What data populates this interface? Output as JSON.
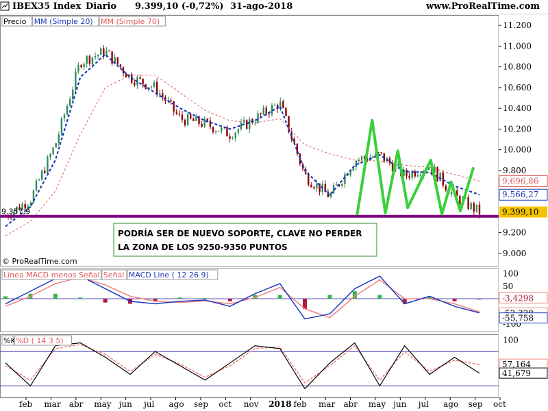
{
  "header": {
    "symbol": "IBEX35 Index",
    "period": "Diario",
    "quote": "9.399,10 (-0,72%)",
    "date": "31-ago-2018",
    "site": "www.ProRealTime.com",
    "icon": "bar-chart-icon"
  },
  "copyright": "© ProRealTime.com",
  "colors": {
    "price_up": "#2e8b57",
    "price_down": "#8b0000",
    "ma20": "#1c39bb",
    "ma70": "#e05a5a",
    "support": "#800080",
    "pattern": "#39d03a",
    "annotation_border": "#2e8b2e",
    "current_price_bg": "#f5c400"
  },
  "chart_data": [
    {
      "type": "line",
      "panel": "price",
      "legend": [
        "Precio",
        "MM (Simple 20)",
        "MM (Simple 70)"
      ],
      "x": [
        "feb",
        "mar",
        "abr",
        "may",
        "jun",
        "jul",
        "ago",
        "sep",
        "oct",
        "nov",
        "2018",
        "feb",
        "mar",
        "abr",
        "may",
        "jun",
        "jul",
        "ago",
        "sep",
        "oct"
      ],
      "ylim": [
        8880,
        11300
      ],
      "yticks": [
        "11.200",
        "11.000",
        "10.800",
        "10.600",
        "10.400",
        "10.200",
        "10.000",
        "9.800",
        "9.200",
        "9.000"
      ],
      "ytick_values": [
        11200,
        11000,
        10800,
        10600,
        10400,
        10200,
        10000,
        9800,
        9200,
        9000
      ],
      "value_labels": [
        {
          "text": "9.696,86",
          "value": 9697,
          "series": "MM (Simple 70)"
        },
        {
          "text": "9.566,27",
          "value": 9566,
          "series": "MM (Simple 20)"
        },
        {
          "text": "9.399,10",
          "value": 9399,
          "series": "Precio"
        }
      ],
      "left_label": "9.357,9",
      "series": [
        {
          "name": "Precio",
          "values": [
            9360,
            9520,
            10050,
            10850,
            10950,
            10700,
            10600,
            10300,
            10250,
            10150,
            10300,
            10450,
            9750,
            9550,
            9900,
            9950,
            9750,
            9850,
            9550,
            9399
          ]
        },
        {
          "name": "MM (Simple 20)",
          "values": [
            9260,
            9450,
            9900,
            10700,
            10920,
            10700,
            10550,
            10400,
            10280,
            10200,
            10280,
            10420,
            9800,
            9560,
            9850,
            9950,
            9790,
            9780,
            9650,
            9566
          ]
        },
        {
          "name": "MM (Simple 70)",
          "values": [
            9170,
            9310,
            9600,
            10150,
            10600,
            10720,
            10720,
            10550,
            10380,
            10280,
            10260,
            10300,
            10050,
            9960,
            9900,
            9890,
            9850,
            9830,
            9760,
            9697
          ]
        }
      ],
      "support_level": 9357.9,
      "annotation": [
        "PODRÍA SER DE NUEVO SOPORTE, CLAVE NO PERDER",
        "LA ZONA DE LOS 9250-9350 PUNTOS"
      ],
      "pattern_points": [
        [
          543,
          9370
        ],
        [
          566,
          10285
        ],
        [
          586,
          9390
        ],
        [
          605,
          9990
        ],
        [
          620,
          9440
        ],
        [
          655,
          9900
        ],
        [
          672,
          9380
        ],
        [
          686,
          9690
        ],
        [
          700,
          9410
        ],
        [
          720,
          9830
        ]
      ]
    },
    {
      "type": "bar",
      "panel": "macd",
      "legend": [
        "Línea MACD menos Señal",
        "Señal",
        "MACD Line ( 12 26 9)"
      ],
      "yticks": [
        "100",
        "50",
        "-100"
      ],
      "ytick_values": [
        100,
        50,
        -100
      ],
      "ylim": [
        -130,
        120
      ],
      "value_labels": [
        {
          "text": "-3,4298",
          "value": -3.4
        },
        {
          "text": "-52,328",
          "value": -52.3
        },
        {
          "text": "-55,758",
          "value": -55.8
        }
      ],
      "series": [
        {
          "name": "MACD Line ( 12 26 9)",
          "values": [
            -20,
            30,
            80,
            90,
            40,
            -10,
            -20,
            -10,
            -5,
            -30,
            20,
            60,
            -80,
            -60,
            40,
            90,
            -20,
            10,
            -30,
            -56
          ]
        },
        {
          "name": "Señal",
          "values": [
            -30,
            10,
            60,
            85,
            55,
            10,
            -10,
            -15,
            -8,
            -20,
            5,
            45,
            -40,
            -75,
            10,
            75,
            0,
            0,
            -20,
            -52
          ]
        },
        {
          "name": "Línea MACD menos Señal",
          "values": [
            10,
            20,
            20,
            5,
            -15,
            -20,
            -10,
            5,
            3,
            -10,
            15,
            15,
            -40,
            15,
            30,
            15,
            -20,
            10,
            -10,
            -3
          ]
        }
      ]
    },
    {
      "type": "line",
      "panel": "stochastic",
      "legend": [
        "%K",
        "%D ( 14 3 5)"
      ],
      "yticks": [
        "100"
      ],
      "ytick_values": [
        100
      ],
      "ylim": [
        0,
        110
      ],
      "value_labels": [
        {
          "text": "57,164",
          "value": 57.2
        },
        {
          "text": "41,679",
          "value": 41.7
        }
      ],
      "series": [
        {
          "name": "%K",
          "values": [
            60,
            20,
            90,
            95,
            70,
            40,
            80,
            55,
            30,
            60,
            90,
            85,
            15,
            60,
            95,
            20,
            90,
            40,
            70,
            42
          ]
        },
        {
          "name": "%D ( 14 3 5)",
          "values": [
            55,
            30,
            85,
            92,
            75,
            45,
            75,
            58,
            35,
            55,
            85,
            88,
            25,
            55,
            90,
            30,
            80,
            45,
            65,
            57
          ]
        }
      ]
    }
  ]
}
